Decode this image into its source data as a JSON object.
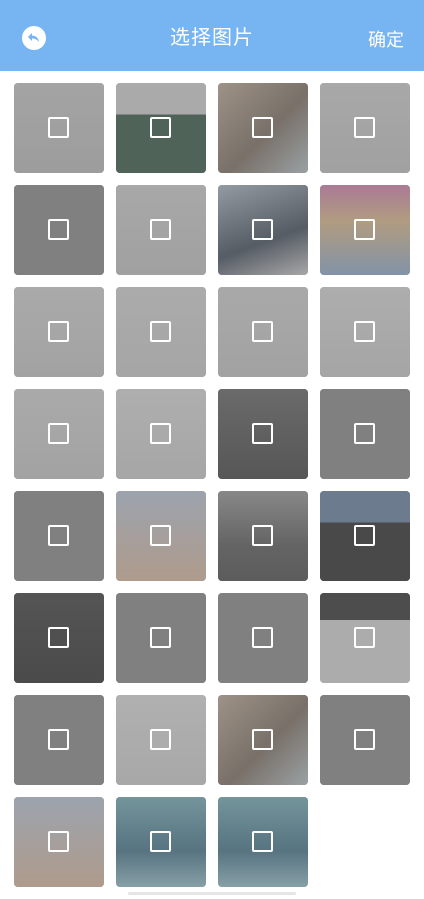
{
  "header": {
    "title": "选择图片",
    "confirm_label": "确定",
    "back_icon": "back-arrow-icon"
  },
  "colors": {
    "header_bg": "#77b4f2",
    "overlay": "#8a8a8a"
  },
  "grid": {
    "columns": 4,
    "items": [
      {
        "thumb": "app-list-screenshot",
        "selected": false
      },
      {
        "thumb": "food-app-screenshot",
        "selected": false
      },
      {
        "thumb": "room-photo",
        "selected": false
      },
      {
        "thumb": "settings-screenshot",
        "selected": false
      },
      {
        "thumb": "blank-gray",
        "selected": false
      },
      {
        "thumb": "settings-screenshot",
        "selected": false
      },
      {
        "thumb": "photo-with-phone",
        "selected": false
      },
      {
        "thumb": "comic-poster",
        "selected": false
      },
      {
        "thumb": "form-screenshot",
        "selected": false
      },
      {
        "thumb": "settings-list-screenshot",
        "selected": false
      },
      {
        "thumb": "menu-screenshot",
        "selected": false
      },
      {
        "thumb": "profile-screenshot",
        "selected": false
      },
      {
        "thumb": "form-screenshot",
        "selected": false
      },
      {
        "thumb": "icon-grid-screenshot",
        "selected": false
      },
      {
        "thumb": "dark-photo",
        "selected": false
      },
      {
        "thumb": "blank-gray",
        "selected": false
      },
      {
        "thumb": "blank-gray",
        "selected": false
      },
      {
        "thumb": "illustration",
        "selected": false
      },
      {
        "thumb": "bw-sea-photo",
        "selected": false
      },
      {
        "thumb": "dark-screenshot",
        "selected": false
      },
      {
        "thumb": "dark-app-screenshot",
        "selected": false
      },
      {
        "thumb": "blank-gray",
        "selected": false
      },
      {
        "thumb": "blank-gray",
        "selected": false
      },
      {
        "thumb": "video-player-screenshot",
        "selected": false
      },
      {
        "thumb": "blank-gray",
        "selected": false
      },
      {
        "thumb": "button-list-screenshot",
        "selected": false
      },
      {
        "thumb": "room-photo",
        "selected": false
      },
      {
        "thumb": "blank-gray",
        "selected": false
      },
      {
        "thumb": "illustration",
        "selected": false
      },
      {
        "thumb": "sea-photo",
        "selected": false
      },
      {
        "thumb": "sea-photo",
        "selected": false
      }
    ]
  }
}
